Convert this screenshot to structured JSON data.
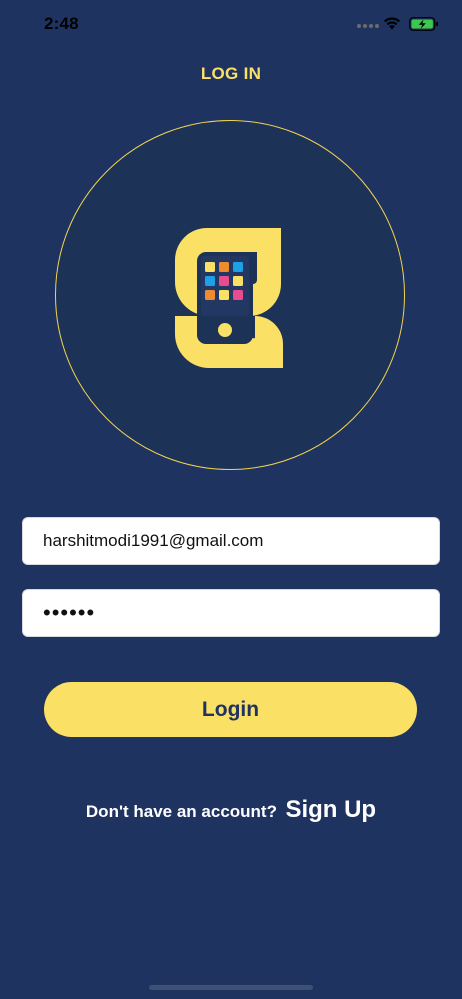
{
  "status_bar": {
    "time": "2:48"
  },
  "header": {
    "title": "LOG IN"
  },
  "form": {
    "email_value": "harshitmodi1991@gmail.com",
    "password_value": "••••••",
    "login_label": "Login"
  },
  "footer": {
    "prompt": "Don't have an account?",
    "signup_label": "Sign Up"
  },
  "colors": {
    "background": "#1f3361",
    "accent": "#fbe066",
    "field_background": "#ffffff"
  },
  "icons": {
    "logo": "app-logo-icon",
    "wifi": "wifi-icon",
    "battery": "battery-charging-icon"
  }
}
